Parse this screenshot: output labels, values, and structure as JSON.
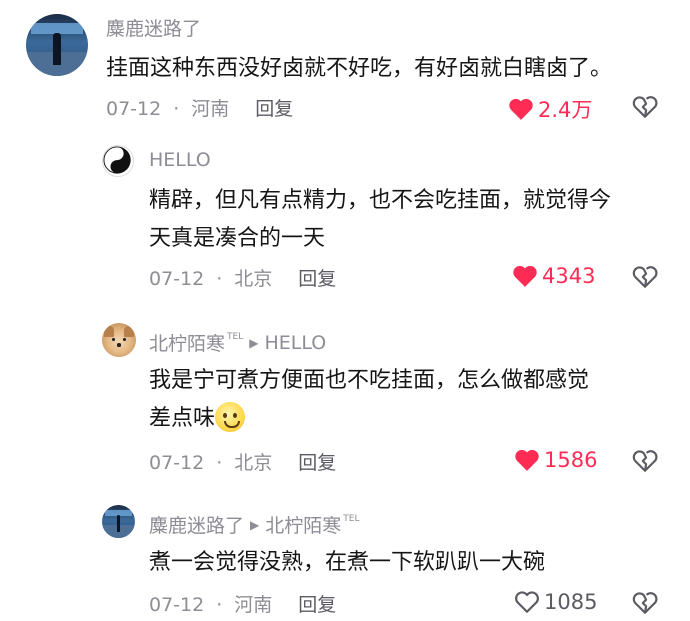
{
  "comments": [
    {
      "author": "麋鹿迷路了",
      "text_lines": [
        "挂面这种东西没好卤就不好吃，有好卤就白瞎卤了。"
      ],
      "date": "07-12",
      "location": "河南",
      "reply_label": "回复",
      "likes": "2.4万",
      "liked": true,
      "avatar_icon": "concert-stage-avatar"
    },
    {
      "author": "HELLO",
      "text_lines": [
        "精辟，但凡有点精力，也不会吃挂面，就觉得今",
        "天真是凑合的一天"
      ],
      "date": "07-12",
      "location": "北京",
      "reply_label": "回复",
      "likes": "4343",
      "liked": true,
      "avatar_icon": "yin-yang-avatar"
    },
    {
      "author": "北柠陌寒",
      "author_tag": "TEL",
      "reply_to": "HELLO",
      "text_lines": [
        "我是宁可煮方便面也不吃挂面，怎么做都感觉",
        "差点味"
      ],
      "date": "07-12",
      "location": "北京",
      "reply_label": "回复",
      "likes": "1586",
      "liked": true,
      "avatar_icon": "shiba-dog-avatar"
    },
    {
      "author": "麋鹿迷路了",
      "reply_to": "北柠陌寒",
      "reply_to_tag": "TEL",
      "text_lines": [
        "煮一会觉得没熟，在煮一下软趴趴一大碗"
      ],
      "date": "07-12",
      "location": "河南",
      "reply_label": "回复",
      "likes": "1085",
      "liked": false,
      "avatar_icon": "concert-stage-avatar"
    }
  ],
  "colors": {
    "accent_red": "#fe2c55",
    "meta_grey": "#8d8d95",
    "text": "#161616"
  }
}
